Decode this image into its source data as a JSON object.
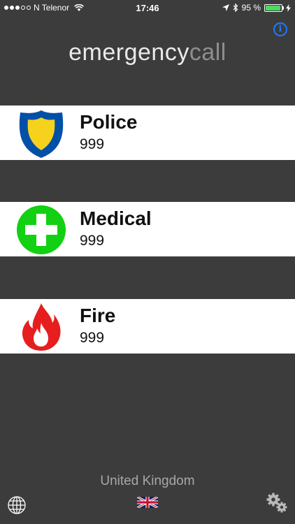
{
  "status_bar": {
    "carrier": "N Telenor",
    "time": "17:46",
    "battery_percent": "95 %",
    "battery_level": 0.95,
    "signal_bars_filled": 3,
    "signal_bars_total": 5
  },
  "header": {
    "title_part1": "emergency",
    "title_part2": "call",
    "info_label": "i"
  },
  "services": [
    {
      "name": "Police",
      "number": "999",
      "icon": "police-badge-icon",
      "color": "#0050a8"
    },
    {
      "name": "Medical",
      "number": "999",
      "icon": "medical-cross-icon",
      "color": "#12d012"
    },
    {
      "name": "Fire",
      "number": "999",
      "icon": "fire-icon",
      "color": "#e61e1e"
    }
  ],
  "footer": {
    "country": "United Kingdom",
    "flag": "uk-flag-icon",
    "globe": "globe-icon",
    "settings": "gears-icon"
  },
  "colors": {
    "background": "#3c3c3c",
    "row_background": "#ffffff",
    "info_blue": "#1e78ff",
    "battery_green": "#4cd964"
  }
}
